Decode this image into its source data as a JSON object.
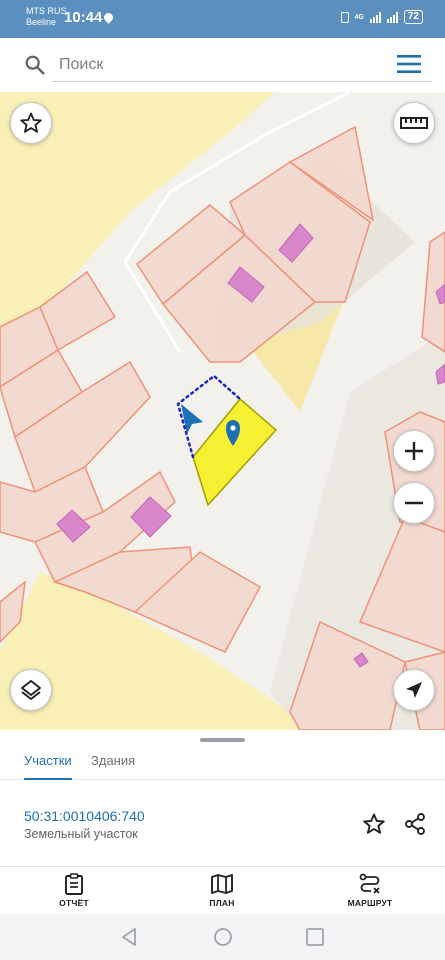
{
  "status_bar": {
    "carrier_1": "MTS RUS",
    "carrier_2": "Beeline",
    "time": "10:44",
    "network": "4G",
    "battery": "72"
  },
  "search": {
    "placeholder": "Поиск"
  },
  "colors": {
    "accent": "#1f6fb5",
    "status_bar": "#5a8fc0",
    "parcel_fill": "#f3d9cf",
    "parcel_stroke": "#ef8a6f",
    "building": "#d986cc",
    "selected_parcel": "#f6f032",
    "yellow_zone": "#f8efb0"
  },
  "map": {
    "icons": [
      "star-icon",
      "ruler-icon",
      "zoom-in-icon",
      "zoom-out-icon",
      "layers-icon",
      "location-arrow-icon",
      "map-pin-icon",
      "direction-arrow-icon"
    ]
  },
  "sheet": {
    "tabs": [
      {
        "label": "Участки",
        "active": true
      },
      {
        "label": "Здания",
        "active": false
      }
    ],
    "parcel": {
      "cadastral_number": "50:31:0010406:740",
      "type": "Земельный участок"
    }
  },
  "bottom_nav": {
    "items": [
      {
        "label": "ОТЧЁТ",
        "icon": "report-icon"
      },
      {
        "label": "ПЛАН",
        "icon": "map-plan-icon"
      },
      {
        "label": "МАРШРУТ",
        "icon": "route-icon"
      }
    ]
  }
}
